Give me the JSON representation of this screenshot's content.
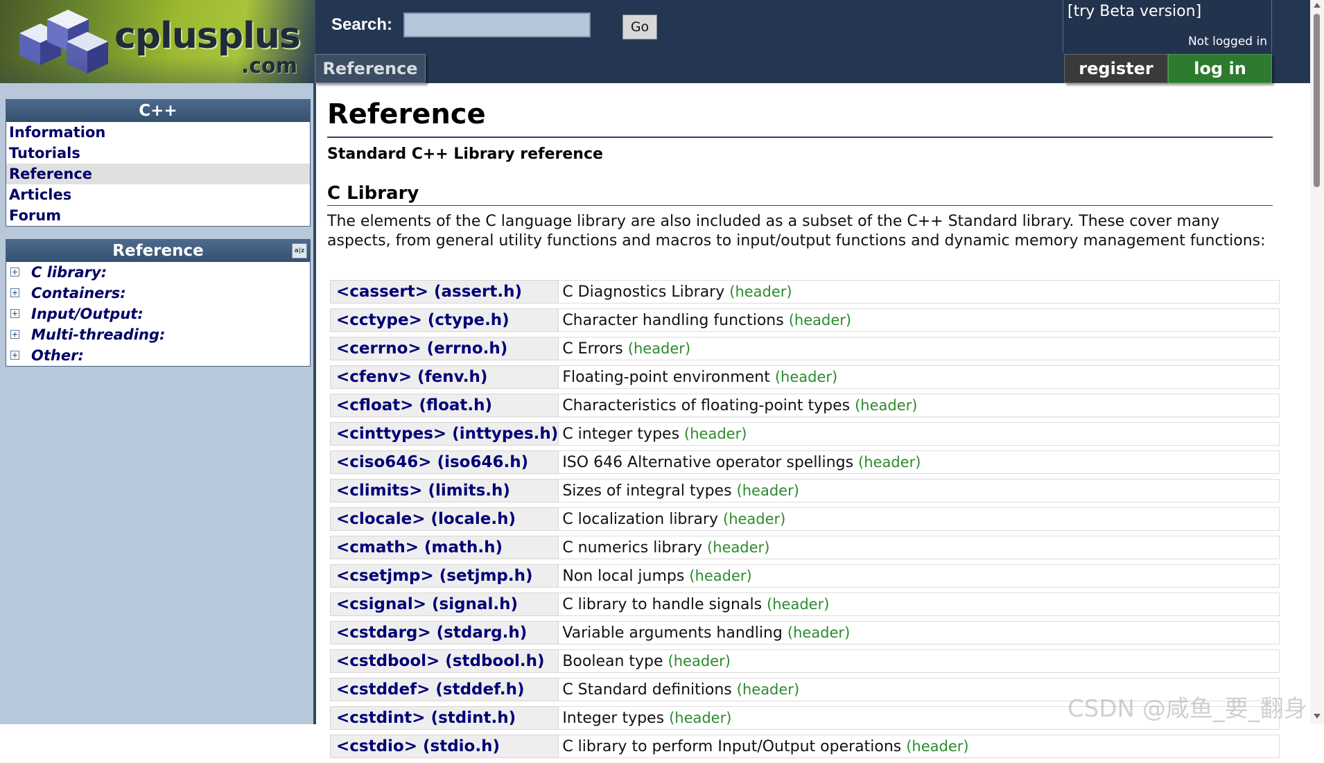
{
  "header": {
    "logo_text": "cplusplus",
    "logo_domain": ".com",
    "search_label": "Search:",
    "search_value": "",
    "go_label": "Go",
    "beta_link": "[try Beta version]",
    "login_status": "Not logged in",
    "nav_tab": "Reference",
    "register_label": "register",
    "login_label": "log in"
  },
  "sidebar": {
    "cpp_box": {
      "title": "C++",
      "items": [
        {
          "label": "Information",
          "active": false
        },
        {
          "label": "Tutorials",
          "active": false
        },
        {
          "label": "Reference",
          "active": true
        },
        {
          "label": "Articles",
          "active": false
        },
        {
          "label": "Forum",
          "active": false
        }
      ]
    },
    "ref_box": {
      "title": "Reference",
      "sort_icon_text": "a|z",
      "items": [
        {
          "label": "C library:"
        },
        {
          "label": "Containers:"
        },
        {
          "label": "Input/Output:"
        },
        {
          "label": "Multi-threading:"
        },
        {
          "label": "Other:"
        }
      ]
    }
  },
  "main": {
    "title": "Reference",
    "subtitle": "Standard C++ Library reference",
    "section_title": "C Library",
    "section_desc": "The elements of the C language library are also included as a subset of the C++ Standard library. These cover many aspects, from general utility functions and macros to input/output functions and dynamic memory management functions:",
    "header_tag": "(header)",
    "libraries": [
      {
        "name": "<cassert> (assert.h)",
        "desc": "C Diagnostics Library"
      },
      {
        "name": "<cctype> (ctype.h)",
        "desc": "Character handling functions"
      },
      {
        "name": "<cerrno> (errno.h)",
        "desc": "C Errors"
      },
      {
        "name": "<cfenv> (fenv.h)",
        "desc": "Floating-point environment"
      },
      {
        "name": "<cfloat> (float.h)",
        "desc": "Characteristics of floating-point types"
      },
      {
        "name": "<cinttypes> (inttypes.h)",
        "desc": "C integer types"
      },
      {
        "name": "<ciso646> (iso646.h)",
        "desc": "ISO 646 Alternative operator spellings"
      },
      {
        "name": "<climits> (limits.h)",
        "desc": "Sizes of integral types"
      },
      {
        "name": "<clocale> (locale.h)",
        "desc": "C localization library"
      },
      {
        "name": "<cmath> (math.h)",
        "desc": "C numerics library"
      },
      {
        "name": "<csetjmp> (setjmp.h)",
        "desc": "Non local jumps"
      },
      {
        "name": "<csignal> (signal.h)",
        "desc": "C library to handle signals"
      },
      {
        "name": "<cstdarg> (stdarg.h)",
        "desc": "Variable arguments handling"
      },
      {
        "name": "<cstdbool> (stdbool.h)",
        "desc": "Boolean type"
      },
      {
        "name": "<cstddef> (stddef.h)",
        "desc": "C Standard definitions"
      },
      {
        "name": "<cstdint> (stdint.h)",
        "desc": "Integer types"
      },
      {
        "name": "<cstdio> (stdio.h)",
        "desc": "C library to perform Input/Output operations"
      }
    ]
  },
  "watermark": "CSDN @咸鱼_要_翻身",
  "colors": {
    "header_bg": "#243652",
    "sidebar_bg": "#b7c8da",
    "link": "#000066",
    "header_tag": "#2b8a2b",
    "login_button": "#2e7a2e"
  }
}
